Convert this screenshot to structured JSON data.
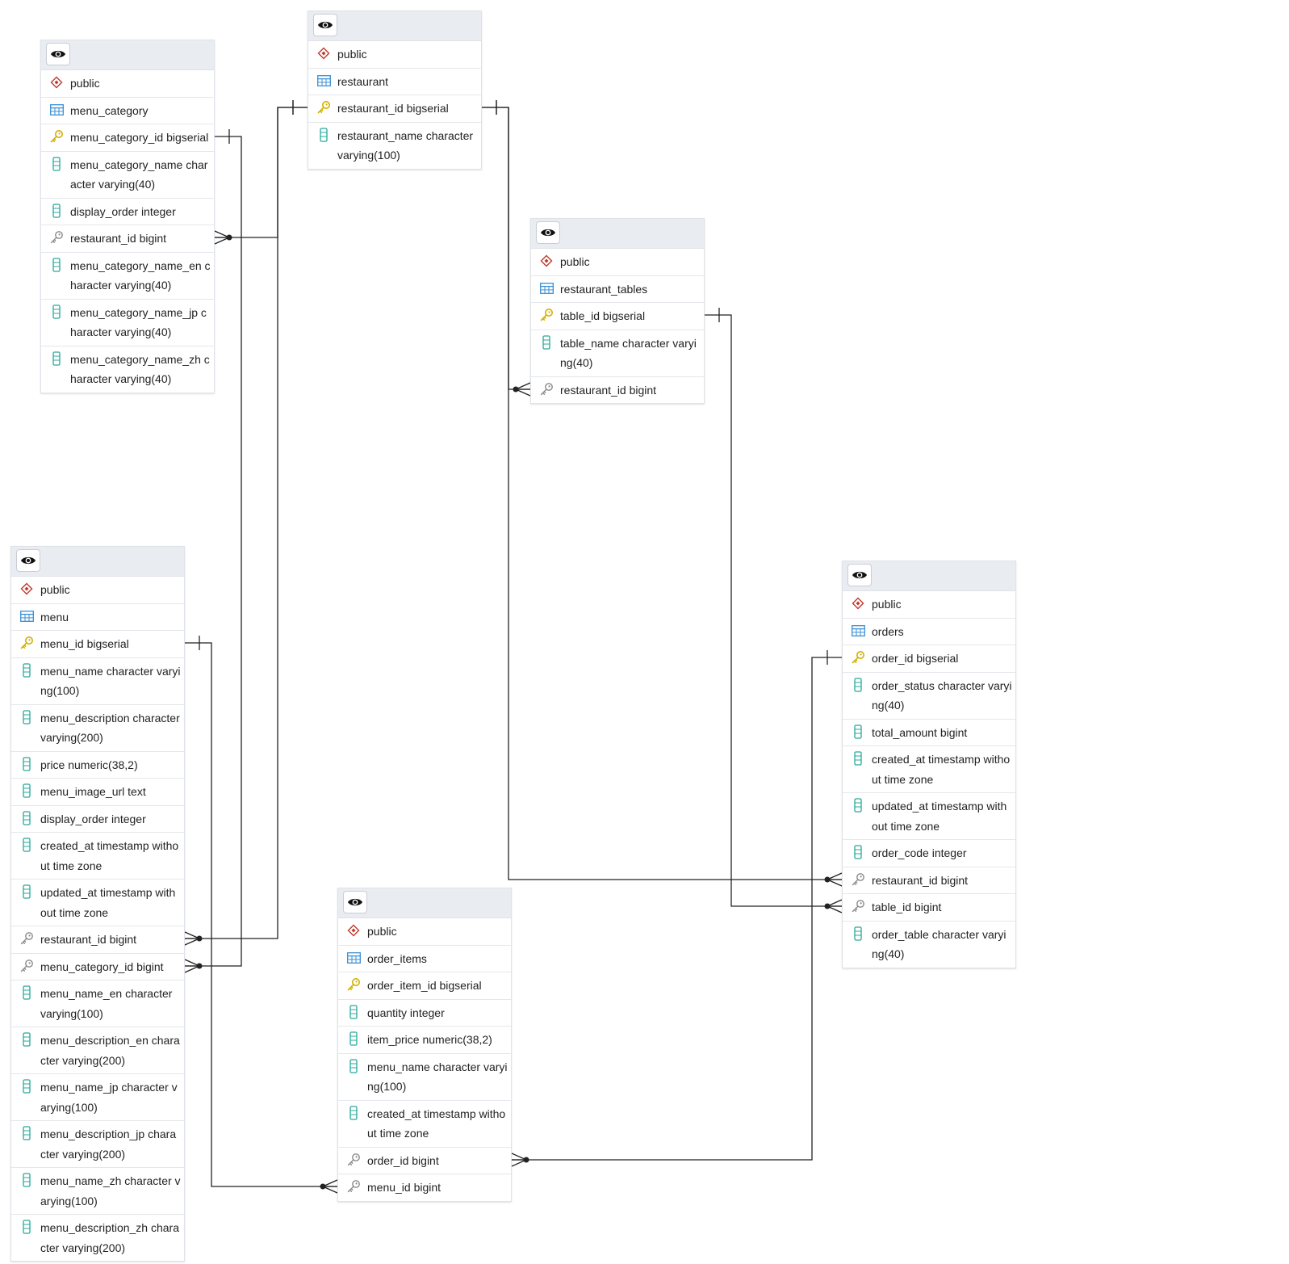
{
  "colors": {
    "schema_icon": "#c0392b",
    "table_icon": "#3b8fd6",
    "pk_icon": "#d4b000",
    "fk_icon": "#8a8a8a",
    "column_icon": "#27a99a",
    "link_line": "#222222",
    "header_bg": "#e9ecf1"
  },
  "icons": {
    "header": "eye-icon",
    "schema": "schema-diamond-icon",
    "table": "table-grid-icon",
    "pk": "primary-key-icon",
    "fk": "foreign-key-icon",
    "column": "column-icon"
  },
  "tables": [
    {
      "id": "menu_category",
      "rows": [
        {
          "kind": "schema",
          "text": "public"
        },
        {
          "kind": "table",
          "text": "menu_category"
        },
        {
          "kind": "pk",
          "text": "menu_category_id bigserial"
        },
        {
          "kind": "column",
          "text": "menu_category_name character varying(40)"
        },
        {
          "kind": "column",
          "text": "display_order integer"
        },
        {
          "kind": "fk",
          "text": "restaurant_id bigint"
        },
        {
          "kind": "column",
          "text": "menu_category_name_en character varying(40)"
        },
        {
          "kind": "column",
          "text": "menu_category_name_jp character varying(40)"
        },
        {
          "kind": "column",
          "text": "menu_category_name_zh character varying(40)"
        }
      ]
    },
    {
      "id": "restaurant",
      "rows": [
        {
          "kind": "schema",
          "text": "public"
        },
        {
          "kind": "table",
          "text": "restaurant"
        },
        {
          "kind": "pk",
          "text": "restaurant_id bigserial"
        },
        {
          "kind": "column",
          "text": "restaurant_name character varying(100)"
        }
      ]
    },
    {
      "id": "restaurant_tables",
      "rows": [
        {
          "kind": "schema",
          "text": "public"
        },
        {
          "kind": "table",
          "text": "restaurant_tables"
        },
        {
          "kind": "pk",
          "text": "table_id bigserial"
        },
        {
          "kind": "column",
          "text": "table_name character varying(40)"
        },
        {
          "kind": "fk",
          "text": "restaurant_id bigint"
        }
      ]
    },
    {
      "id": "menu",
      "rows": [
        {
          "kind": "schema",
          "text": "public"
        },
        {
          "kind": "table",
          "text": "menu"
        },
        {
          "kind": "pk",
          "text": "menu_id bigserial"
        },
        {
          "kind": "column",
          "text": "menu_name character varying(100)"
        },
        {
          "kind": "column",
          "text": "menu_description character varying(200)"
        },
        {
          "kind": "column",
          "text": "price numeric(38,2)"
        },
        {
          "kind": "column",
          "text": "menu_image_url text"
        },
        {
          "kind": "column",
          "text": "display_order integer"
        },
        {
          "kind": "column",
          "text": "created_at timestamp without time zone"
        },
        {
          "kind": "column",
          "text": "updated_at timestamp without time zone"
        },
        {
          "kind": "fk",
          "text": "restaurant_id bigint"
        },
        {
          "kind": "fk",
          "text": "menu_category_id bigint"
        },
        {
          "kind": "column",
          "text": "menu_name_en character varying(100)"
        },
        {
          "kind": "column",
          "text": "menu_description_en character varying(200)"
        },
        {
          "kind": "column",
          "text": "menu_name_jp character varying(100)"
        },
        {
          "kind": "column",
          "text": "menu_description_jp character varying(200)"
        },
        {
          "kind": "column",
          "text": "menu_name_zh character varying(100)"
        },
        {
          "kind": "column",
          "text": "menu_description_zh character varying(200)"
        }
      ]
    },
    {
      "id": "orders",
      "rows": [
        {
          "kind": "schema",
          "text": "public"
        },
        {
          "kind": "table",
          "text": "orders"
        },
        {
          "kind": "pk",
          "text": "order_id bigserial"
        },
        {
          "kind": "column",
          "text": "order_status character varying(40)"
        },
        {
          "kind": "column",
          "text": "total_amount bigint"
        },
        {
          "kind": "column",
          "text": "created_at timestamp without time zone"
        },
        {
          "kind": "column",
          "text": "updated_at timestamp without time zone"
        },
        {
          "kind": "column",
          "text": "order_code integer"
        },
        {
          "kind": "fk",
          "text": "restaurant_id bigint"
        },
        {
          "kind": "fk",
          "text": "table_id bigint"
        },
        {
          "kind": "column",
          "text": "order_table character varying(40)"
        }
      ]
    },
    {
      "id": "order_items",
      "rows": [
        {
          "kind": "schema",
          "text": "public"
        },
        {
          "kind": "table",
          "text": "order_items"
        },
        {
          "kind": "pk",
          "text": "order_item_id bigserial"
        },
        {
          "kind": "column",
          "text": "quantity integer"
        },
        {
          "kind": "column",
          "text": "item_price numeric(38,2)"
        },
        {
          "kind": "column",
          "text": "menu_name character varying(100)"
        },
        {
          "kind": "column",
          "text": "created_at timestamp without time zone"
        },
        {
          "kind": "fk",
          "text": "order_id bigint"
        },
        {
          "kind": "fk",
          "text": "menu_id bigint"
        }
      ]
    }
  ],
  "relations": [
    {
      "from": "menu_category.restaurant_id",
      "to": "restaurant.restaurant_id"
    },
    {
      "from": "menu.restaurant_id",
      "to": "restaurant.restaurant_id"
    },
    {
      "from": "menu.menu_category_id",
      "to": "menu_category.menu_category_id"
    },
    {
      "from": "restaurant_tables.restaurant_id",
      "to": "restaurant.restaurant_id"
    },
    {
      "from": "orders.restaurant_id",
      "to": "restaurant.restaurant_id"
    },
    {
      "from": "orders.table_id",
      "to": "restaurant_tables.table_id"
    },
    {
      "from": "order_items.order_id",
      "to": "orders.order_id"
    },
    {
      "from": "order_items.menu_id",
      "to": "menu.menu_id"
    }
  ]
}
